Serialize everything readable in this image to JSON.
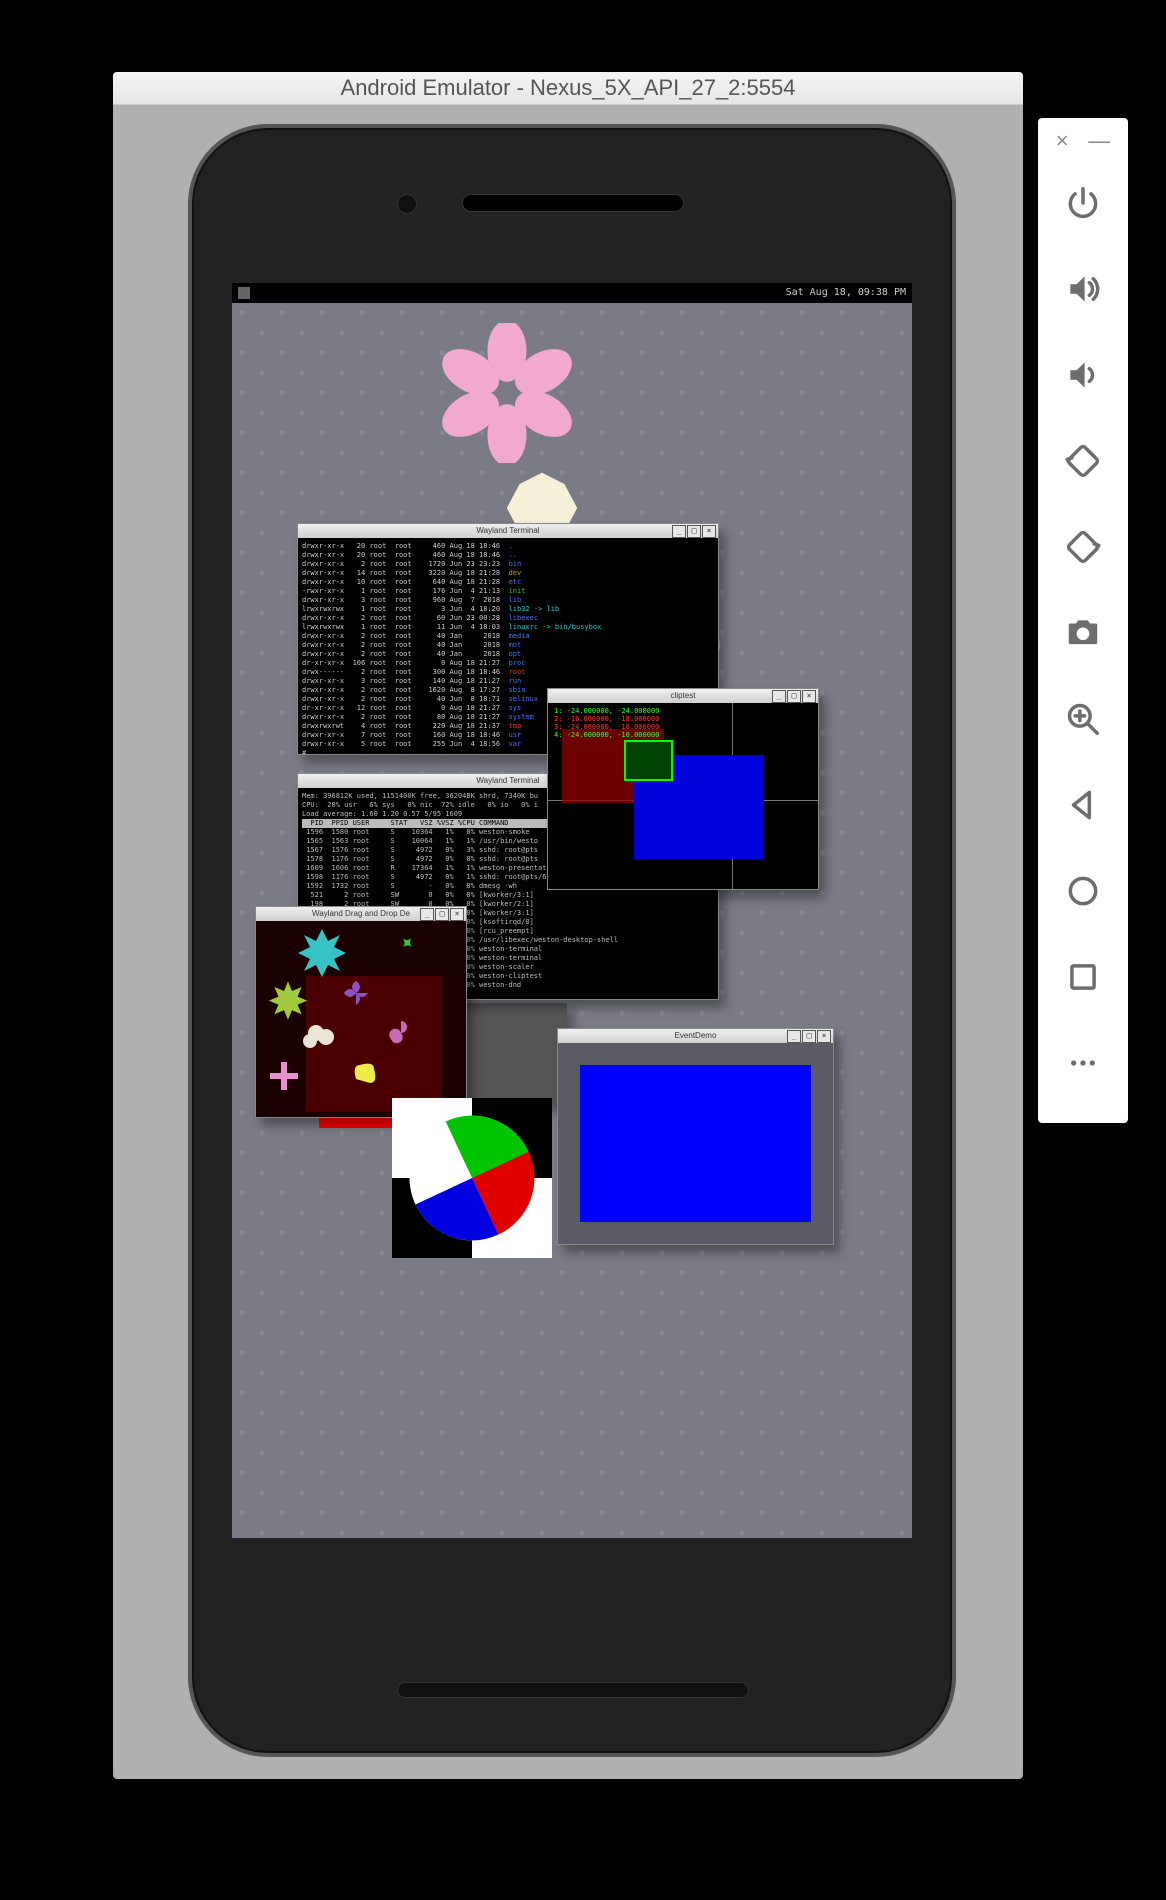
{
  "emulator": {
    "title": "Android Emulator - Nexus_5X_API_27_2:5554"
  },
  "statusbar": {
    "datetime": "Sat Aug 18, 09:38 PM"
  },
  "windows": {
    "term1": {
      "title": "Wayland Terminal",
      "lines": [
        {
          "perm": "drwxr-xr-x",
          "n": "20",
          "u": "root",
          "g": "root",
          "sz": "460",
          "dt": "Aug 18 18:46",
          "name": ".",
          "cls": "d"
        },
        {
          "perm": "drwxr-xr-x",
          "n": "20",
          "u": "root",
          "g": "root",
          "sz": "460",
          "dt": "Aug 18 18:46",
          "name": "..",
          "cls": "d"
        },
        {
          "perm": "drwxr-xr-x",
          "n": "2",
          "u": "root",
          "g": "root",
          "sz": "1720",
          "dt": "Jun 23 23:23",
          "name": "bin",
          "cls": "d"
        },
        {
          "perm": "drwxr-xr-x",
          "n": "14",
          "u": "root",
          "g": "root",
          "sz": "3220",
          "dt": "Aug 18 21:28",
          "name": "dev",
          "cls": "y"
        },
        {
          "perm": "drwxr-xr-x",
          "n": "10",
          "u": "root",
          "g": "root",
          "sz": "640",
          "dt": "Aug 18 21:28",
          "name": "etc",
          "cls": "d"
        },
        {
          "perm": "-rwxr-xr-x",
          "n": "1",
          "u": "root",
          "g": "root",
          "sz": "176",
          "dt": "Jun  4 21:13",
          "name": "init",
          "cls": "g"
        },
        {
          "perm": "drwxr-xr-x",
          "n": "3",
          "u": "root",
          "g": "root",
          "sz": "960",
          "dt": "Aug  7  2018",
          "name": "lib",
          "cls": "d"
        },
        {
          "perm": "lrwxrwxrwx",
          "n": "1",
          "u": "root",
          "g": "root",
          "sz": "3",
          "dt": "Jun  4 18:20",
          "name": "lib32 -> lib",
          "cls": "l"
        },
        {
          "perm": "drwxr-xr-x",
          "n": "2",
          "u": "root",
          "g": "root",
          "sz": "60",
          "dt": "Jun 23 00:28",
          "name": "libexec",
          "cls": "d"
        },
        {
          "perm": "lrwxrwxrwx",
          "n": "1",
          "u": "root",
          "g": "root",
          "sz": "11",
          "dt": "Jun  4 18:03",
          "name": "linuxrc -> bin/busybox",
          "cls": "l"
        },
        {
          "perm": "drwxr-xr-x",
          "n": "2",
          "u": "root",
          "g": "root",
          "sz": "40",
          "dt": "Jan     2018",
          "name": "media",
          "cls": "d"
        },
        {
          "perm": "drwxr-xr-x",
          "n": "2",
          "u": "root",
          "g": "root",
          "sz": "40",
          "dt": "Jan     2018",
          "name": "mnt",
          "cls": "d"
        },
        {
          "perm": "drwxr-xr-x",
          "n": "2",
          "u": "root",
          "g": "root",
          "sz": "40",
          "dt": "Jan     2018",
          "name": "opt",
          "cls": "d"
        },
        {
          "perm": "dr-xr-xr-x",
          "n": "106",
          "u": "root",
          "g": "root",
          "sz": "0",
          "dt": "Aug 18 21:27",
          "name": "proc",
          "cls": "d"
        },
        {
          "perm": "drwx------",
          "n": "2",
          "u": "root",
          "g": "root",
          "sz": "300",
          "dt": "Aug 18 18:46",
          "name": "root",
          "cls": "r"
        },
        {
          "perm": "drwxr-xr-x",
          "n": "3",
          "u": "root",
          "g": "root",
          "sz": "140",
          "dt": "Aug 18 21:27",
          "name": "run",
          "cls": "d"
        },
        {
          "perm": "drwxr-xr-x",
          "n": "2",
          "u": "root",
          "g": "root",
          "sz": "1620",
          "dt": "Aug  8 17:27",
          "name": "sbin",
          "cls": "d"
        },
        {
          "perm": "drwxr-xr-x",
          "n": "2",
          "u": "root",
          "g": "root",
          "sz": "40",
          "dt": "Jun  8 18:71",
          "name": "selinux",
          "cls": "d"
        },
        {
          "perm": "dr-xr-xr-x",
          "n": "12",
          "u": "root",
          "g": "root",
          "sz": "0",
          "dt": "Aug 18 21:27",
          "name": "sys",
          "cls": "d"
        },
        {
          "perm": "drwxr-xr-x",
          "n": "2",
          "u": "root",
          "g": "root",
          "sz": "80",
          "dt": "Aug 18 21:27",
          "name": "system",
          "cls": "d"
        },
        {
          "perm": "drwxrwxrwt",
          "n": "4",
          "u": "root",
          "g": "root",
          "sz": "220",
          "dt": "Aug 18 21:37",
          "name": "tmp",
          "cls": "r"
        },
        {
          "perm": "drwxr-xr-x",
          "n": "7",
          "u": "root",
          "g": "root",
          "sz": "160",
          "dt": "Aug 18 18:46",
          "name": "usr",
          "cls": "d"
        },
        {
          "perm": "drwxr-xr-x",
          "n": "5",
          "u": "root",
          "g": "root",
          "sz": "255",
          "dt": "Jun  4 18:56",
          "name": "var",
          "cls": "d"
        }
      ]
    },
    "term2": {
      "title": "Wayland Terminal",
      "header1": "Mem: 396812K used, 1151400K free, 36204BK shrd, 7340K bu",
      "header2": "CPU:  20% usr   6% sys   0% nic  72% idle   0% io   0% i",
      "header3": "Load average: 1.60 1.20 0.57 5/95 1609",
      "cols": "  PID  PPID USER     STAT   VSZ %VSZ %CPU COMMAND",
      "procs": [
        " 1596  1580 root     S    10364   1%   0% weston-smoke",
        " 1565  1563 root     S    10064   1%   1% /usr/bin/westo",
        " 1567  1576 root     S     4972   0%   3% sshd: root@pts",
        " 1578  1176 root     S     4972   0%   0% sshd: root@pts",
        " 1609  1606 root     R    17364   1%   1% weston-presentation-shu",
        " 1598  1176 root     S     4972   0%   1% sshd: root@pts/6",
        " 1592  1732 root     S        -   0%   0% dmesg -wh",
        "  521     2 root     SW       0   0%   0% [kworker/3:1]",
        "  198     2 root     SW       0   0%   0% [kworker/2:1]",
        " 1101     2 root     SW       0   0%   0% [kworker/3:1]",
        "    6     2 root     SW       0   0%   0% [ksoftirqd/0]",
        "    8     2 root     SW       0   0%   0% [rcu_preempt]",
        " 1585  1565 root     S    12110   1%   0% /usr/libexec/weston-desktop-shell",
        "                                  0%   0% weston-terminal",
        "                                  0%   0% weston-terminal",
        "                                  0%   0% weston-scaler",
        "                                  0%   0% weston-cliptest",
        "                                  0%   0% weston-dnd"
      ]
    },
    "cliptest": {
      "title": "cliptest",
      "lines": [
        "1: -24.000000, -24.000000",
        "2: -16.000000, -18.000000",
        "3: -24.000000, -16.000000",
        "4: -24.000000, -10.000000"
      ]
    },
    "dnd": {
      "title": "Wayland Drag and Drop De"
    },
    "eventdemo": {
      "title": "EventDemo"
    }
  },
  "toolbar": {
    "close": "×",
    "min": "—"
  }
}
